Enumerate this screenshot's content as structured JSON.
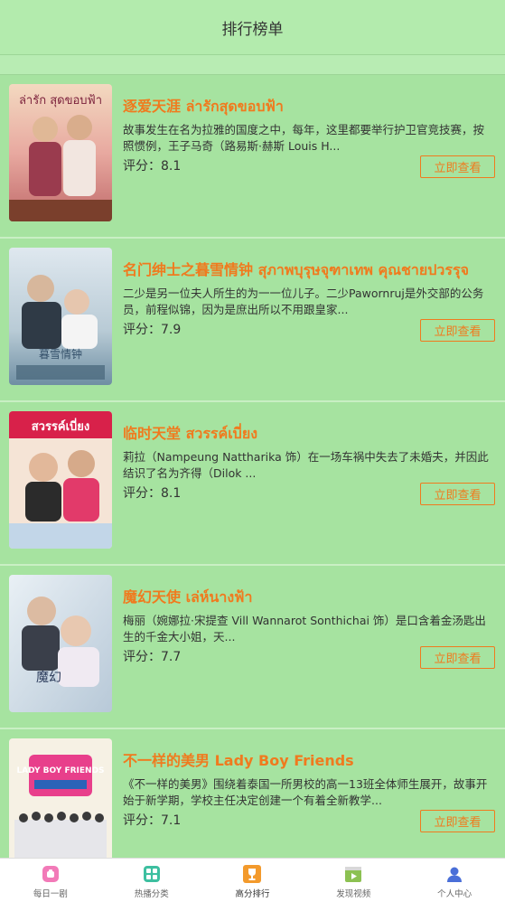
{
  "header": {
    "title": "排行榜单"
  },
  "list": {
    "rating_label": "评分：",
    "items": [
      {
        "title": "逐爱天涯 ล่ารักสุดขอบฟ้า",
        "description": "故事发生在名为拉雅的国度之中，每年，这里都要举行护卫官竞技赛，按照惯例，王子马奇（路易斯·赫斯 Louis H...",
        "rating": "8.1",
        "button": "立即查看",
        "poster_text": "ล่ารัก สุดขอบฟ้า"
      },
      {
        "title": "名门绅士之暮雪情钟 สุภาพบุรุษจุฑาเทพ คุณชายปวรรุจ",
        "description": "二少是另一位夫人所生的为一一位儿子。二少Pawornruj是外交部的公务员，前程似锦，因为是庶出所以不用跟皇家...",
        "rating": "7.9",
        "button": "立即查看",
        "poster_text": "暮雪情钟"
      },
      {
        "title": "临时天堂 สวรรค์เบี่ยง",
        "description": "莉拉（Nampeung Nattharika 饰）在一场车祸中失去了未婚夫，并因此结识了名为齐得（Dilok ...",
        "rating": "8.1",
        "button": "立即查看",
        "poster_text": "สวรรค์เบี่ยง"
      },
      {
        "title": "魔幻天使 เล่ห์นางฟ้า",
        "description": "梅丽（婉娜拉·宋提查 Vill Wannarot Sonthichai 饰）是口含着金汤匙出生的千金大小姐，天...",
        "rating": "7.7",
        "button": "立即查看",
        "poster_text": "魔幻"
      },
      {
        "title": "不一样的美男 Lady Boy Friends",
        "description": "《不一样的美男》围绕着泰国一所男校的高一13班全体师生展开，故事开始于新学期，学校主任决定创建一个有着全新教学...",
        "rating": "7.1",
        "button": "立即查看",
        "poster_text": "LADY BOY FRIENDS"
      }
    ]
  },
  "tabs": [
    {
      "label": "每日一剧",
      "icon": "daily-drama-icon",
      "color": "#f27ab8"
    },
    {
      "label": "热播分类",
      "icon": "category-grid-icon",
      "color": "#3dbfa0"
    },
    {
      "label": "高分排行",
      "icon": "trophy-icon",
      "color": "#f39a2c",
      "active": true
    },
    {
      "label": "发现视频",
      "icon": "film-play-icon",
      "color": "#8cc152"
    },
    {
      "label": "个人中心",
      "icon": "user-profile-icon",
      "color": "#4a6fd8"
    }
  ]
}
